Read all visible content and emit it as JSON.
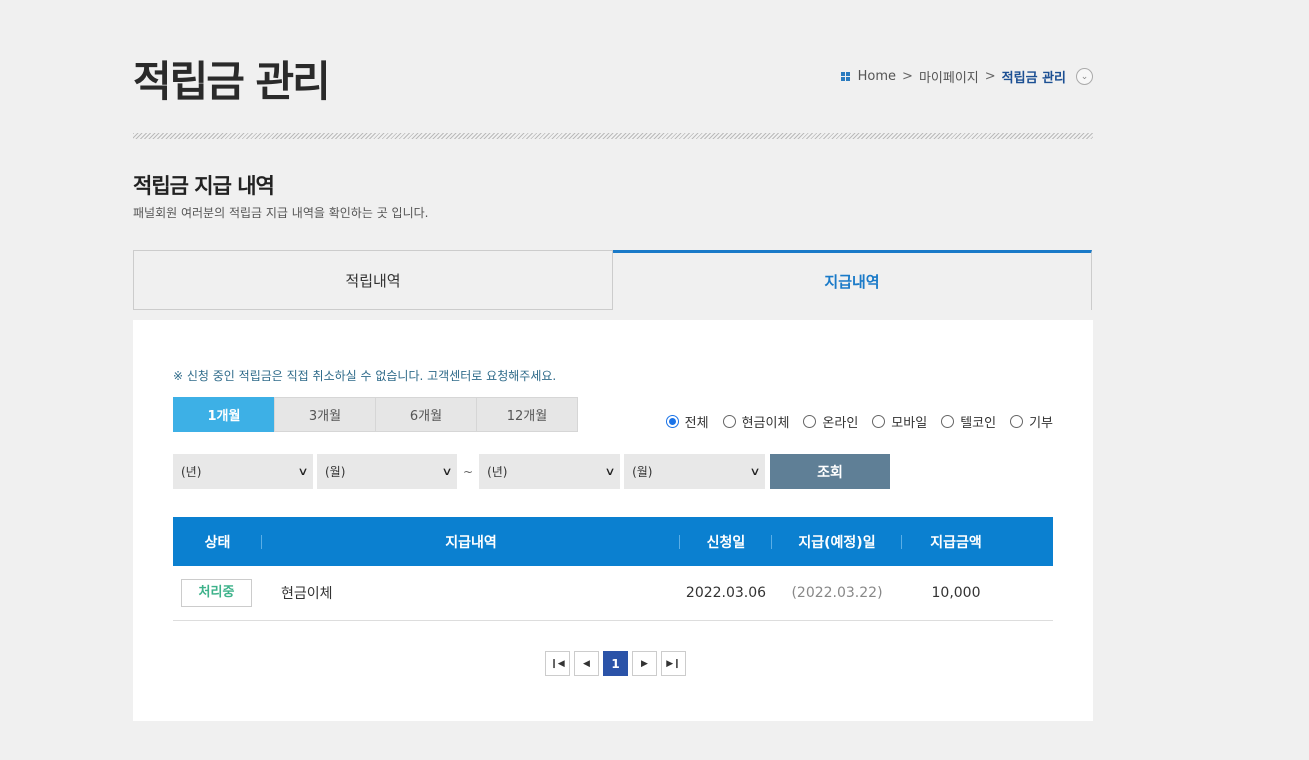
{
  "page": {
    "title": "적립금 관리"
  },
  "breadcrumb": {
    "home": "Home",
    "sep": ">",
    "mypage": "마이페이지",
    "current": "적립금 관리"
  },
  "section": {
    "title": "적립금 지급 내역",
    "description": "패널회원 여러분의 적립금 지급 내역을 확인하는 곳 입니다."
  },
  "tabs": [
    {
      "label": "적립내역",
      "active": false
    },
    {
      "label": "지급내역",
      "active": true
    }
  ],
  "notice": "※ 신청 중인 적립금은 직접 취소하실 수 없습니다. 고객센터로 요청해주세요.",
  "period_buttons": [
    {
      "label": "1개월",
      "active": true
    },
    {
      "label": "3개월",
      "active": false
    },
    {
      "label": "6개월",
      "active": false
    },
    {
      "label": "12개월",
      "active": false
    }
  ],
  "radios": [
    {
      "label": "전체",
      "checked": true
    },
    {
      "label": "현금이체",
      "checked": false
    },
    {
      "label": "온라인",
      "checked": false
    },
    {
      "label": "모바일",
      "checked": false
    },
    {
      "label": "텔코인",
      "checked": false
    },
    {
      "label": "기부",
      "checked": false
    }
  ],
  "filter": {
    "from_year": "(년)",
    "from_month": "(월)",
    "tilde": "~",
    "to_year": "(년)",
    "to_month": "(월)",
    "query_label": "조회"
  },
  "table": {
    "headers": [
      "상태",
      "지급내역",
      "신청일",
      "지급(예정)일",
      "지급금액"
    ],
    "rows": [
      {
        "status": "처리중",
        "type": "현금이체",
        "applied": "2022.03.06",
        "paid": "(2022.03.22)",
        "amount": "10,000"
      }
    ]
  },
  "pagination": {
    "current": "1"
  },
  "colors": {
    "accent": "#0b80d0",
    "period_active": "#3db0e6",
    "query_button": "#5f7f96",
    "status_text": "#3db28a",
    "page_active": "#2b53a8"
  }
}
